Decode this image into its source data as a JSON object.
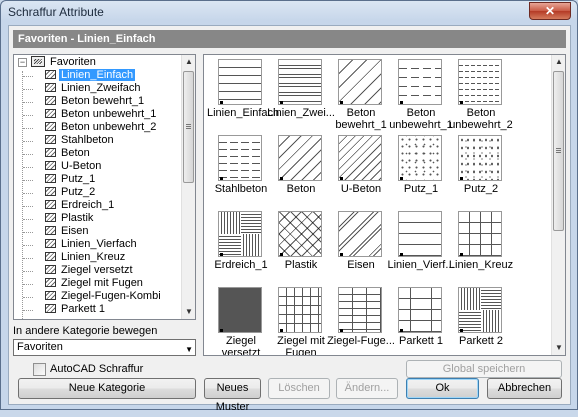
{
  "window": {
    "title": "Schraffur Attribute",
    "close_glyph": "✕"
  },
  "header": {
    "title": "Favoriten - Linien_Einfach"
  },
  "tree": {
    "root_label": "Favoriten",
    "expander_glyph": "−",
    "selected_index": 0,
    "items": [
      "Linien_Einfach",
      "Linien_Zweifach",
      "Beton bewehrt_1",
      "Beton unbewehrt_1",
      "Beton unbewehrt_2",
      "Stahlbeton",
      "Beton",
      "U-Beton",
      "Putz_1",
      "Putz_2",
      "Erdreich_1",
      "Plastik",
      "Eisen",
      "Linien_Vierfach",
      "Linien_Kreuz",
      "Ziegel versetzt",
      "Ziegel mit Fugen",
      "Ziegel-Fugen-Kombi",
      "Parkett 1"
    ]
  },
  "move_category": {
    "label": "In andere Kategorie bewegen",
    "selected": "Favoriten"
  },
  "patterns": [
    {
      "label": "Linien_Einfach",
      "pattern": "lines"
    },
    {
      "label": "Linien_Zwei...",
      "pattern": "lines2"
    },
    {
      "label": "Beton\nbewehrt_1",
      "pattern": "diag"
    },
    {
      "label": "Beton\nunbewehrt_1",
      "pattern": "dash"
    },
    {
      "label": "Beton\nunbewehrt_2",
      "pattern": "dash2"
    },
    {
      "label": "Stahlbeton",
      "pattern": "stahl"
    },
    {
      "label": "Beton",
      "pattern": "beton"
    },
    {
      "label": "U-Beton",
      "pattern": "ubeton"
    },
    {
      "label": "Putz_1",
      "pattern": "dots"
    },
    {
      "label": "Putz_2",
      "pattern": "dots2"
    },
    {
      "label": "Erdreich_1",
      "pattern": "weave"
    },
    {
      "label": "Plastik",
      "pattern": "cross"
    },
    {
      "label": "Eisen",
      "pattern": "eisen"
    },
    {
      "label": "Linien_Vierf...",
      "pattern": "vierfach"
    },
    {
      "label": "Linien_Kreuz",
      "pattern": "kreuz"
    },
    {
      "label": "Ziegel versetzt",
      "pattern": "brick"
    },
    {
      "label": "Ziegel mit\nFugen",
      "pattern": "brick2"
    },
    {
      "label": "Ziegel-Fuge...",
      "pattern": "brick3"
    },
    {
      "label": "Parkett 1",
      "pattern": "parkett1"
    },
    {
      "label": "Parkett 2",
      "pattern": "parkett2"
    }
  ],
  "buttons": {
    "global_save": "Global speichern",
    "autocad_label": "AutoCAD Schraffur",
    "autocad_checked": false,
    "new_category": "Neue Kategorie",
    "new_pattern": "Neues Muster",
    "delete": "Löschen",
    "change": "Ändern...",
    "ok": "Ok",
    "cancel": "Abbrechen"
  },
  "scroll_glyphs": {
    "up": "▲",
    "down": "▼"
  }
}
